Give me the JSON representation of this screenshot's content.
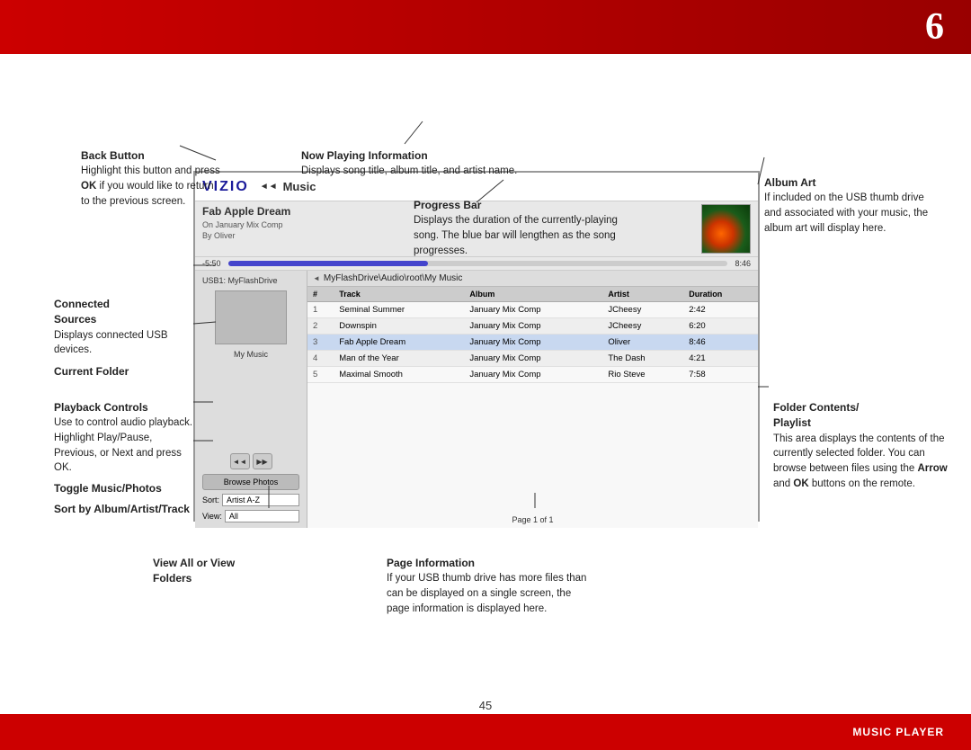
{
  "page": {
    "number": "6",
    "page_num": "45",
    "bottom_label": "MUSIC PLAYER"
  },
  "annotations": {
    "back_button": {
      "title": "Back Button",
      "text": "Highlight this button and press OK if you would like to return to the previous screen.",
      "ok_bold": "OK"
    },
    "now_playing": {
      "title": "Now Playing Information",
      "text": "Displays song title, album title, and artist name."
    },
    "album_art": {
      "title": "Album Art",
      "text": "If included on the USB thumb drive and associated with your music, the album art will display here."
    },
    "progress_bar": {
      "title": "Progress Bar",
      "text": "Displays the duration of the currently-playing song. The blue bar will lengthen as the song progresses."
    },
    "connected_sources": {
      "title": "Connected Sources",
      "text": "Displays connected USB devices."
    },
    "current_folder": {
      "title": "Current Folder"
    },
    "playback_controls": {
      "title": "Playback Controls",
      "text": "Use to control audio playback. Highlight Play/Pause, Previous, or Next and press OK."
    },
    "toggle_music": {
      "title": "Toggle Music/Photos"
    },
    "sort_by": {
      "title": "Sort by Album/Artist/Track"
    },
    "view_all": {
      "title": "View All or View Folders"
    },
    "page_information": {
      "title": "Page Information",
      "text": "If your USB thumb drive has more files than can be displayed on a single screen, the page information is displayed here."
    },
    "folder_contents": {
      "title": "Folder Contents/ Playlist",
      "text": "This area displays the contents of the currently selected folder. You can browse between files using the Arrow and OK buttons on the remote.",
      "arrow_bold": "Arrow",
      "ok_bold": "OK"
    }
  },
  "tv_ui": {
    "vizio_logo": "VIZIO",
    "back_icon": "◄◄",
    "music_label": "Music",
    "usb_label": "USB1: MyFlashDrive",
    "folder_label": "My Music",
    "now_playing_title": "Fab Apple Dream",
    "on_label": "On",
    "album_label": "January Mix Comp",
    "by_label": "By",
    "artist_label": "Oliver",
    "time_elapsed": "-5:50",
    "time_total": "8:46",
    "path": "MyFlashDrive\\Audio\\root\\My Music",
    "path_arrow": "◄",
    "browse_photos": "Browse Photos",
    "sort_label": "Sort:",
    "sort_value": "Artist A-Z",
    "view_label": "View:",
    "view_value": "All",
    "page_info": "Page 1 of 1",
    "table_headers": [
      "#",
      "Track",
      "Album",
      "Artist",
      "Duration"
    ],
    "tracks": [
      {
        "num": "1",
        "track": "Seminal Summer",
        "album": "January Mix Comp",
        "artist": "JCheesy",
        "duration": "2:42",
        "highlighted": false
      },
      {
        "num": "2",
        "track": "Downspin",
        "album": "January Mix Comp",
        "artist": "JCheesy",
        "duration": "6:20",
        "highlighted": false
      },
      {
        "num": "3",
        "track": "Fab Apple Dream",
        "album": "January Mix Comp",
        "artist": "Oliver",
        "duration": "8:46",
        "highlighted": true
      },
      {
        "num": "4",
        "track": "Man of the Year",
        "album": "January Mix Comp",
        "artist": "The Dash",
        "duration": "4:21",
        "highlighted": false
      },
      {
        "num": "5",
        "track": "Maximal Smooth",
        "album": "January Mix Comp",
        "artist": "Rio Steve",
        "duration": "7:58",
        "highlighted": false
      }
    ]
  }
}
